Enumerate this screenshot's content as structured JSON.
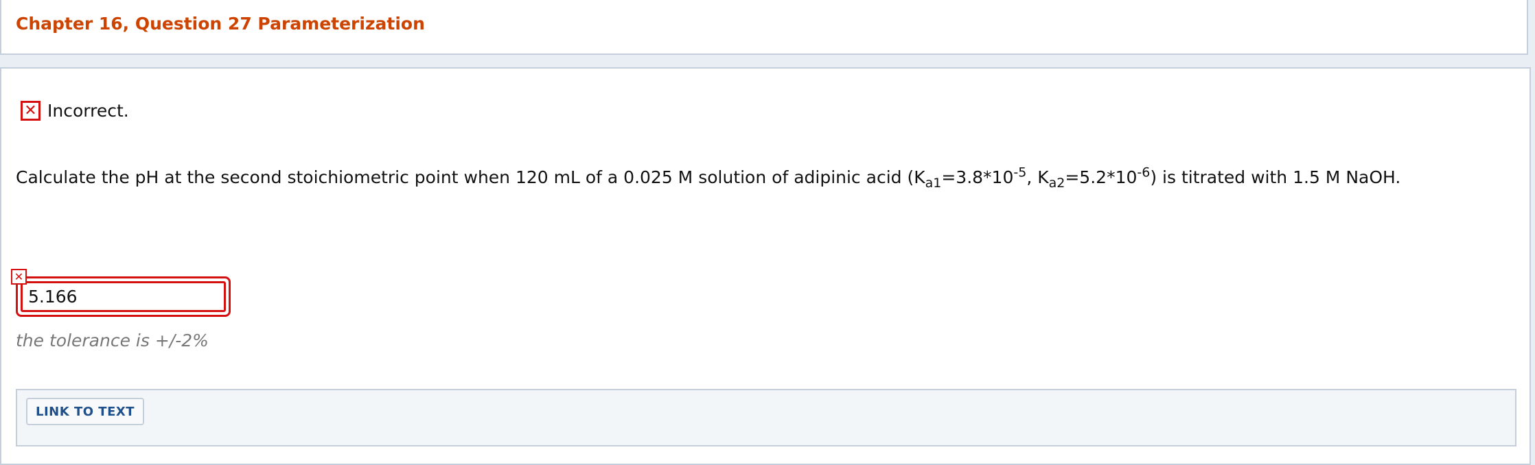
{
  "header": {
    "title": "Chapter 16, Question 27 Parameterization"
  },
  "feedback": {
    "status_icon": "x-mark-icon",
    "status_label": "Incorrect."
  },
  "question": {
    "text_1": "Calculate the pH at the second stoichiometric point when 120 mL of a 0.025 M solution of adipinic acid (K",
    "ka1_sub": "a1",
    "text_2": "=3.8*10",
    "ka1_exp": "-5",
    "text_3": ", K",
    "ka2_sub": "a2",
    "text_4": "=5.2*10",
    "ka2_exp": "-6",
    "text_5": ") is titrated with 1.5 M NaOH."
  },
  "answer": {
    "value": "5.166",
    "status_icon": "x-mark-icon"
  },
  "tolerance": "the tolerance is +/-2%",
  "links": {
    "link_to_text": "LINK TO TEXT"
  },
  "colors": {
    "title": "#cc4400",
    "error": "#d41010",
    "link": "#1f4f8a",
    "border": "#c5cfdb"
  }
}
